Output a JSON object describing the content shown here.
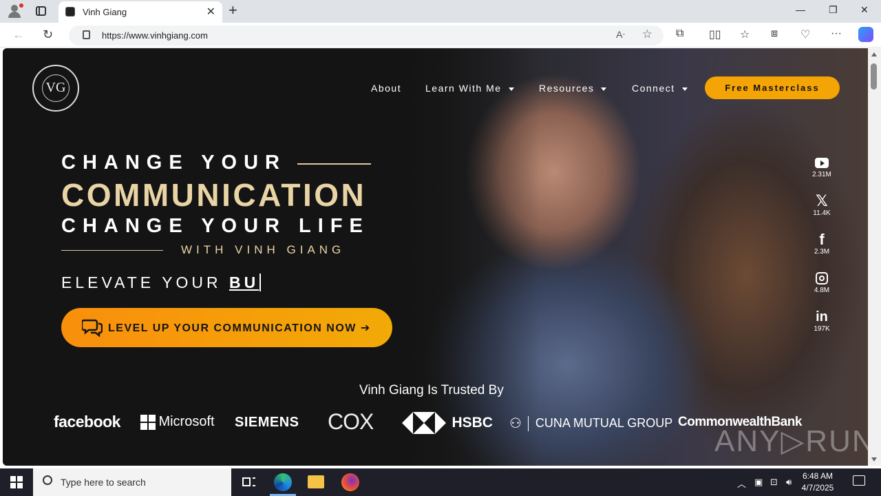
{
  "browser": {
    "tab_title": "Vinh Giang",
    "url": "https://www.vinhgiang.com",
    "new_tab": "+",
    "minimize": "—",
    "restore": "❐",
    "close": "✕"
  },
  "nav": {
    "about": "About",
    "learn": "Learn With Me",
    "resources": "Resources",
    "connect": "Connect",
    "cta": "Free Masterclass"
  },
  "hero": {
    "line1": "CHANGE YOUR",
    "line2": "COMMUNICATION",
    "line3": "CHANGE YOUR LIFE",
    "with": "WITH VINH GIANG",
    "elevate_prefix": "ELEVATE YOUR ",
    "elevate_typed": "BU",
    "cta": "LEVEL UP YOUR COMMUNICATION NOW"
  },
  "social": [
    {
      "icon": "youtube-icon",
      "count": "2.31M"
    },
    {
      "icon": "x-icon",
      "count": "11.4K"
    },
    {
      "icon": "facebook-icon",
      "count": "2.3M"
    },
    {
      "icon": "instagram-icon",
      "count": "4.8M"
    },
    {
      "icon": "linkedin-icon",
      "count": "197K"
    }
  ],
  "trusted": {
    "heading": "Vinh Giang Is Trusted By",
    "brands": [
      "facebook",
      "Microsoft",
      "SIEMENS",
      "COX",
      "HSBC",
      "CUNA MUTUAL GROUP",
      "CommonwealthBank"
    ]
  },
  "watermark": "ANY▷RUN",
  "taskbar": {
    "search_placeholder": "Type here to search",
    "time": "6:48 AM",
    "date": "4/7/2025"
  },
  "colors": {
    "accent": "#f4a405",
    "gold_text": "#e9d4a6",
    "page_bg": "#141414"
  }
}
